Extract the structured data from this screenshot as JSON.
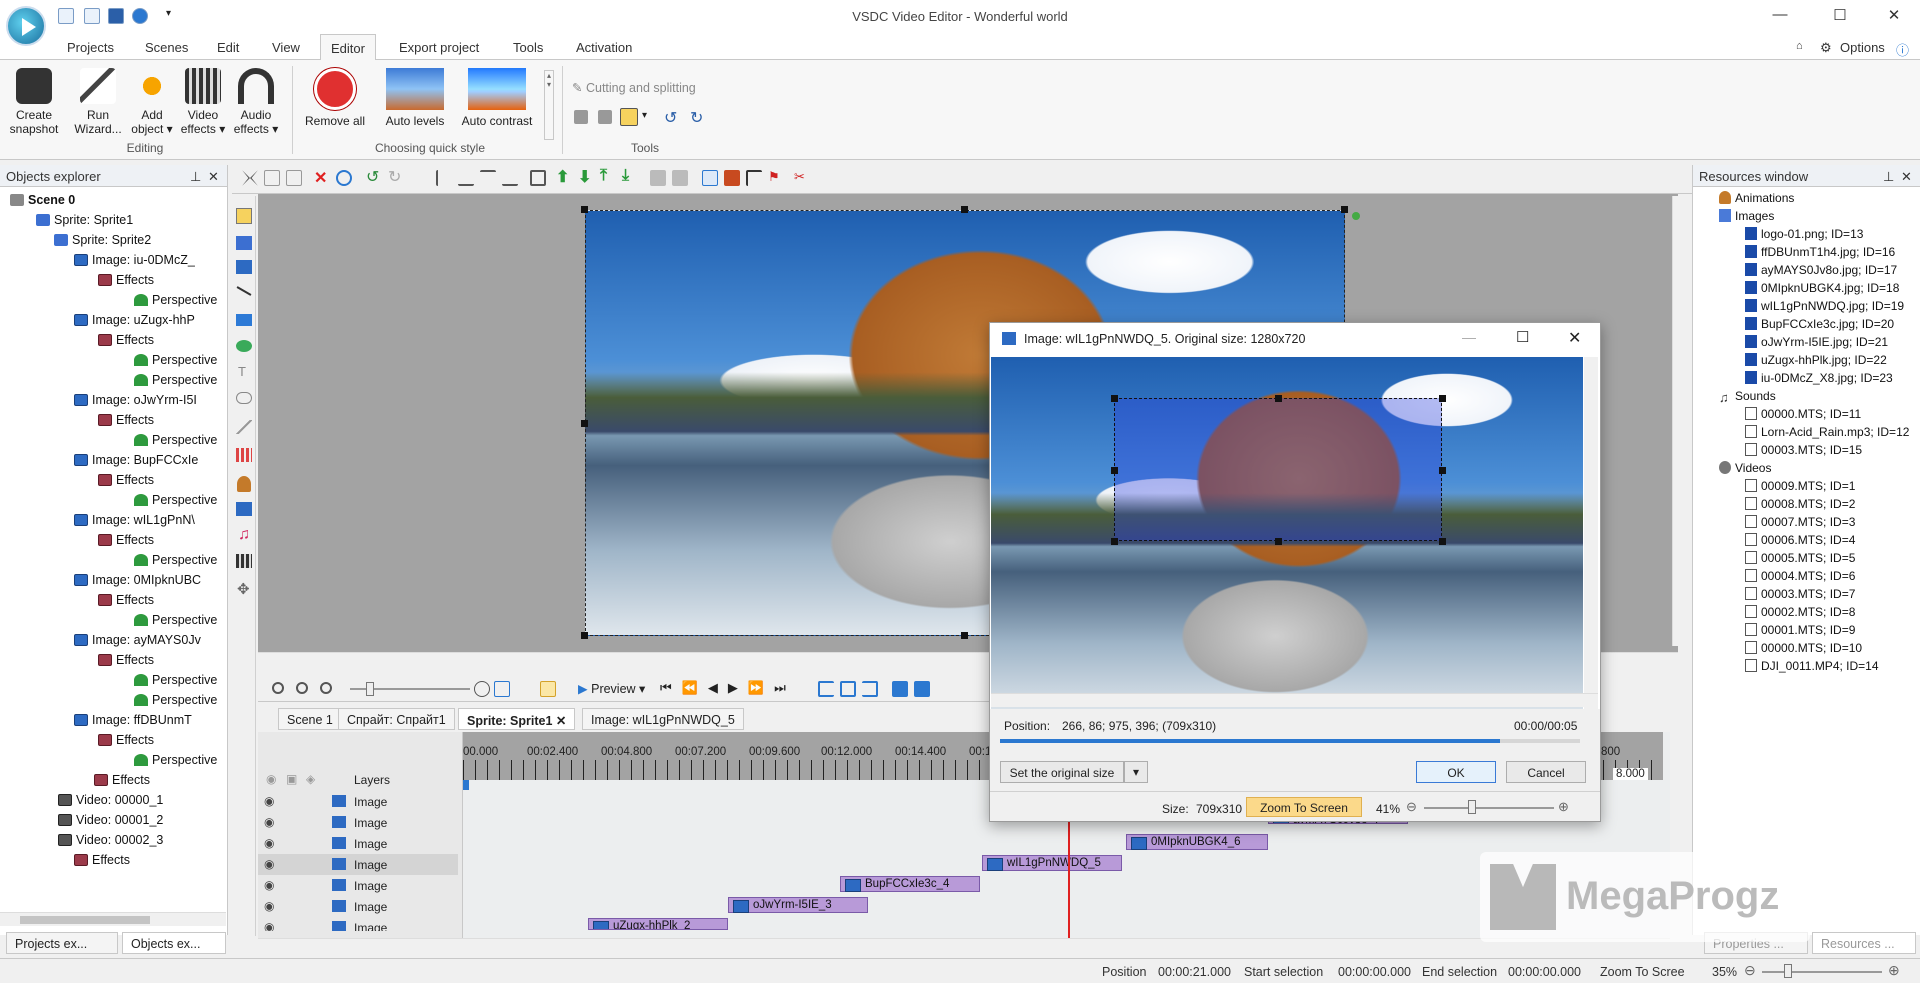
{
  "app": {
    "title": "VSDC Video Editor - Wonderful world"
  },
  "menu": {
    "projects": "Projects",
    "scenes": "Scenes",
    "edit": "Edit",
    "view": "View",
    "editor": "Editor",
    "export": "Export project",
    "tools": "Tools",
    "activation": "Activation",
    "options": "Options"
  },
  "ribbon": {
    "create_snapshot_1": "Create",
    "create_snapshot_2": "snapshot",
    "run_wizard_1": "Run",
    "run_wizard_2": "Wizard...",
    "add_object_1": "Add",
    "add_object_2": "object ▾",
    "video_effects_1": "Video",
    "video_effects_2": "effects ▾",
    "audio_effects_1": "Audio",
    "audio_effects_2": "effects ▾",
    "group_editing": "Editing",
    "remove_all": "Remove all",
    "auto_levels": "Auto levels",
    "auto_contrast": "Auto contrast",
    "group_quick_style": "Choosing quick style",
    "cutting": "Cutting and splitting",
    "group_tools": "Tools"
  },
  "objects_explorer": {
    "title": "Objects explorer",
    "rows": [
      {
        "label": "Scene 0"
      },
      {
        "label": "Sprite: Sprite1"
      },
      {
        "label": "Sprite: Sprite2"
      },
      {
        "label": "Image: iu-0DMcZ_"
      },
      {
        "label": "Effects"
      },
      {
        "label": "Perspective"
      },
      {
        "label": "Image: uZugx-hhP"
      },
      {
        "label": "Effects"
      },
      {
        "label": "Perspective"
      },
      {
        "label": "Perspective"
      },
      {
        "label": "Image: oJwYrm-I5I"
      },
      {
        "label": "Effects"
      },
      {
        "label": "Perspective"
      },
      {
        "label": "Image: BupFCCxIe"
      },
      {
        "label": "Effects"
      },
      {
        "label": "Perspective"
      },
      {
        "label": "Image: wIL1gPnN\\"
      },
      {
        "label": "Effects"
      },
      {
        "label": "Perspective"
      },
      {
        "label": "Image: 0MIpknUBC"
      },
      {
        "label": "Effects"
      },
      {
        "label": "Perspective"
      },
      {
        "label": "Image: ayMAYS0Jv"
      },
      {
        "label": "Effects"
      },
      {
        "label": "Perspective"
      },
      {
        "label": "Perspective"
      },
      {
        "label": "Image: ffDBUnmT"
      },
      {
        "label": "Effects"
      },
      {
        "label": "Perspective"
      },
      {
        "label": "Effects"
      },
      {
        "label": "Video: 00000_1"
      },
      {
        "label": "Video: 00001_2"
      },
      {
        "label": "Video: 00002_3"
      },
      {
        "label": "Effects"
      }
    ],
    "bottom_tab_1": "Projects ex...",
    "bottom_tab_2": "Objects ex..."
  },
  "timeline": {
    "preview": "Preview",
    "tabs": [
      "Scene 1",
      "Спрайт: Спрайт1",
      "Sprite: Sprite1",
      "Image: wIL1gPnNWDQ_5"
    ],
    "ruler": [
      "00.000",
      "00:02.400",
      "00:04.800",
      "00:07.200",
      "00:09.600",
      "00:12.000",
      "00:14.400",
      "00:16.800",
      "00:40.800"
    ],
    "ruler_end": "8.000",
    "layers_label": "Layers",
    "track_label": "Image",
    "clips": [
      "ayMAYS0Jv8o_7",
      "0MIpknUBGK4_6",
      "wIL1gPnNWDQ_5",
      "BupFCCxIe3c_4",
      "oJwYrm-I5IE_3",
      "uZugx-hhPlk_2"
    ]
  },
  "dialog": {
    "title": "Image: wIL1gPnNWDQ_5. Original size: 1280x720",
    "position_label": "Position:",
    "position_value": "266, 86; 975, 396; (709x310)",
    "time": "00:00/00:05",
    "set_original": "Set the original size",
    "ok": "OK",
    "cancel": "Cancel",
    "size_label": "Size:",
    "size_value": "709x310",
    "zoom_to_screen": "Zoom To Screen",
    "zoom": "41%"
  },
  "resources": {
    "title": "Resources window",
    "rows": [
      {
        "label": "Animations"
      },
      {
        "label": "Images"
      },
      {
        "label": "logo-01.png; ID=13"
      },
      {
        "label": "ffDBUnmT1h4.jpg; ID=16"
      },
      {
        "label": "ayMAYS0Jv8o.jpg; ID=17"
      },
      {
        "label": "0MIpknUBGK4.jpg; ID=18"
      },
      {
        "label": "wIL1gPnNWDQ.jpg; ID=19"
      },
      {
        "label": "BupFCCxIe3c.jpg; ID=20"
      },
      {
        "label": "oJwYrm-I5IE.jpg; ID=21"
      },
      {
        "label": "uZugx-hhPlk.jpg; ID=22"
      },
      {
        "label": "iu-0DMcZ_X8.jpg; ID=23"
      },
      {
        "label": "Sounds"
      },
      {
        "label": "00000.MTS; ID=11"
      },
      {
        "label": "Lorn-Acid_Rain.mp3; ID=12"
      },
      {
        "label": "00003.MTS; ID=15"
      },
      {
        "label": "Videos"
      },
      {
        "label": "00009.MTS; ID=1"
      },
      {
        "label": "00008.MTS; ID=2"
      },
      {
        "label": "00007.MTS; ID=3"
      },
      {
        "label": "00006.MTS; ID=4"
      },
      {
        "label": "00005.MTS; ID=5"
      },
      {
        "label": "00004.MTS; ID=6"
      },
      {
        "label": "00003.MTS; ID=7"
      },
      {
        "label": "00002.MTS; ID=8"
      },
      {
        "label": "00001.MTS; ID=9"
      },
      {
        "label": "00000.MTS; ID=10"
      },
      {
        "label": "DJI_0011.MP4; ID=14"
      }
    ],
    "bottom_tab_1": "Properties ...",
    "bottom_tab_2": "Resources ..."
  },
  "status": {
    "position_label": "Position",
    "position_value": "00:00:21.000",
    "start_label": "Start selection",
    "start_value": "00:00:00.000",
    "end_label": "End selection",
    "end_value": "00:00:00.000",
    "zoom_label": "Zoom To Scree",
    "zoom_value": "35%"
  },
  "watermark": "MegaProgz",
  "colors": {
    "accent": "#2b78d0",
    "clip": "#b89ad8",
    "zoom_highlight": "#fbd98a"
  }
}
